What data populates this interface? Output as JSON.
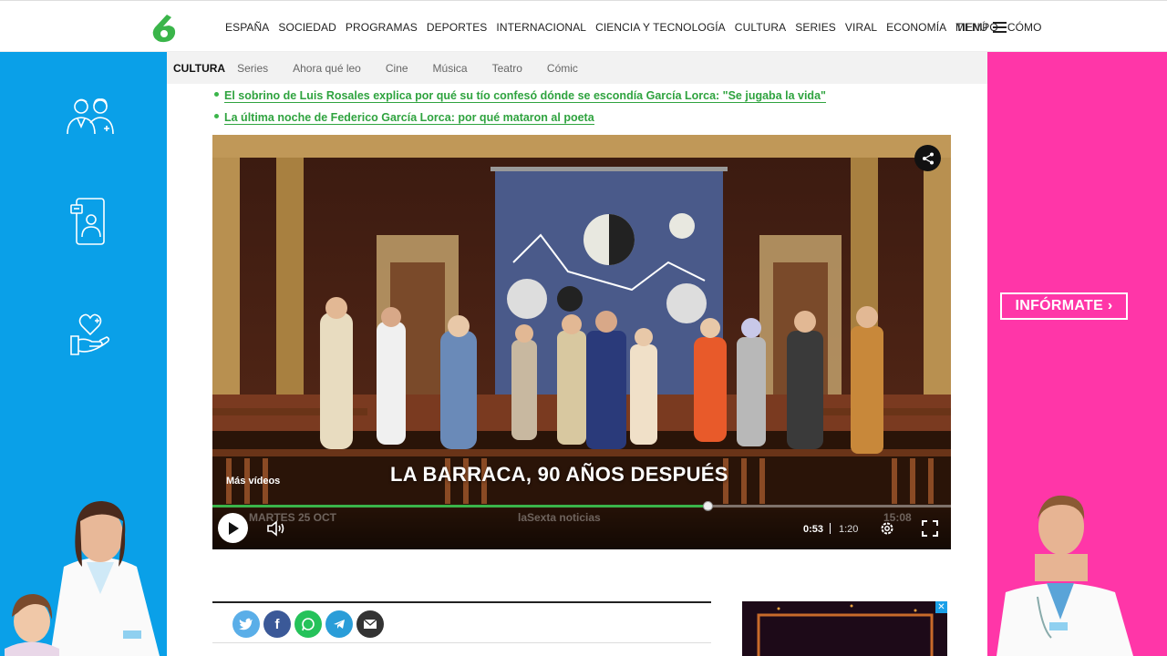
{
  "nav": {
    "links": [
      "ESPAÑA",
      "SOCIEDAD",
      "PROGRAMAS",
      "DEPORTES",
      "INTERNACIONAL",
      "CIENCIA Y TECNOLOGÍA",
      "CULTURA",
      "SERIES",
      "VIRAL",
      "ECONOMÍA",
      "TIEMPO",
      "CÓMO"
    ],
    "menu_label": "MENÚ"
  },
  "subnav": {
    "active": "CULTURA",
    "items": [
      "Series",
      "Ahora qué leo",
      "Cine",
      "Música",
      "Teatro",
      "Cómic"
    ]
  },
  "related": [
    "El sobrino de Luis Rosales explica por qué su tío confesó dónde se escondía García Lorca: \"Se jugaba la vida\"",
    "La última noche de Federico García Lorca: por qué mataron al poeta"
  ],
  "video": {
    "more_videos": "Más vídeos",
    "caption": "LA BARRACA, 90 AÑOS DESPUÉS",
    "bug_date": "MARTES 25 OCT",
    "bug_logo": "laSexta  noticias",
    "bug_time": "15:08",
    "current_time": "0:53",
    "duration": "1:20",
    "progress": 0.67
  },
  "ad_right": {
    "cta": "INFÓRMATE"
  },
  "colors": {
    "accent_green": "#3ab54a",
    "ad_left_bg": "#0aa0e8",
    "ad_right_bg": "#ff36a8"
  },
  "share": {
    "icons": [
      "twitter-icon",
      "facebook-icon",
      "whatsapp-icon",
      "telegram-icon",
      "email-icon"
    ]
  }
}
